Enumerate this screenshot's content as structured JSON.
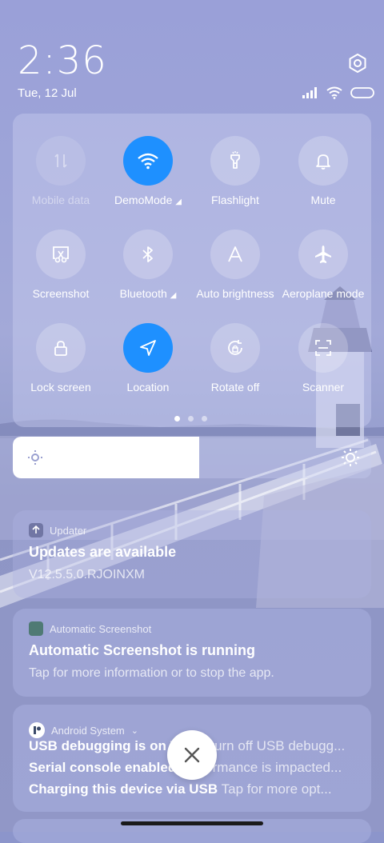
{
  "status": {
    "time": "2:36",
    "date": "Tue, 12 Jul"
  },
  "quick_settings": {
    "tiles": [
      {
        "label": "Mobile data",
        "icon": "mobile-data-icon",
        "state": "disabled"
      },
      {
        "label": "DemoMode",
        "icon": "wifi-icon",
        "state": "on"
      },
      {
        "label": "Flashlight",
        "icon": "flashlight-icon",
        "state": "off"
      },
      {
        "label": "Mute",
        "icon": "bell-icon",
        "state": "off"
      },
      {
        "label": "Screenshot",
        "icon": "screenshot-icon",
        "state": "off"
      },
      {
        "label": "Bluetooth",
        "icon": "bluetooth-icon",
        "state": "off"
      },
      {
        "label": "Auto brightness",
        "icon": "auto-brightness-icon",
        "state": "off"
      },
      {
        "label": "Aeroplane mode",
        "icon": "airplane-icon",
        "state": "off"
      },
      {
        "label": "Lock screen",
        "icon": "lock-icon",
        "state": "off"
      },
      {
        "label": "Location",
        "icon": "location-icon",
        "state": "on"
      },
      {
        "label": "Rotate off",
        "icon": "rotate-icon",
        "state": "off"
      },
      {
        "label": "Scanner",
        "icon": "scanner-icon",
        "state": "off"
      }
    ],
    "page_count": 3,
    "active_page": 1,
    "brightness_level": 0.52,
    "accent_color": "#1e90ff"
  },
  "notifications": [
    {
      "app": "Updater",
      "title": "Updates are available",
      "body": "V12.5.5.0.RJOINXM"
    },
    {
      "app": "Automatic Screenshot",
      "title": "Automatic Screenshot is running",
      "body": "Tap for more information or to stop the app."
    },
    {
      "app": "Android System",
      "lines": [
        {
          "bold": "USB debugging is on",
          "rest": "Tap to turn off USB debugg..."
        },
        {
          "bold": "Serial console enabled",
          "rest": "Performance is impacted..."
        },
        {
          "bold": "Charging this device via USB",
          "rest": "Tap for more opt..."
        }
      ]
    }
  ]
}
